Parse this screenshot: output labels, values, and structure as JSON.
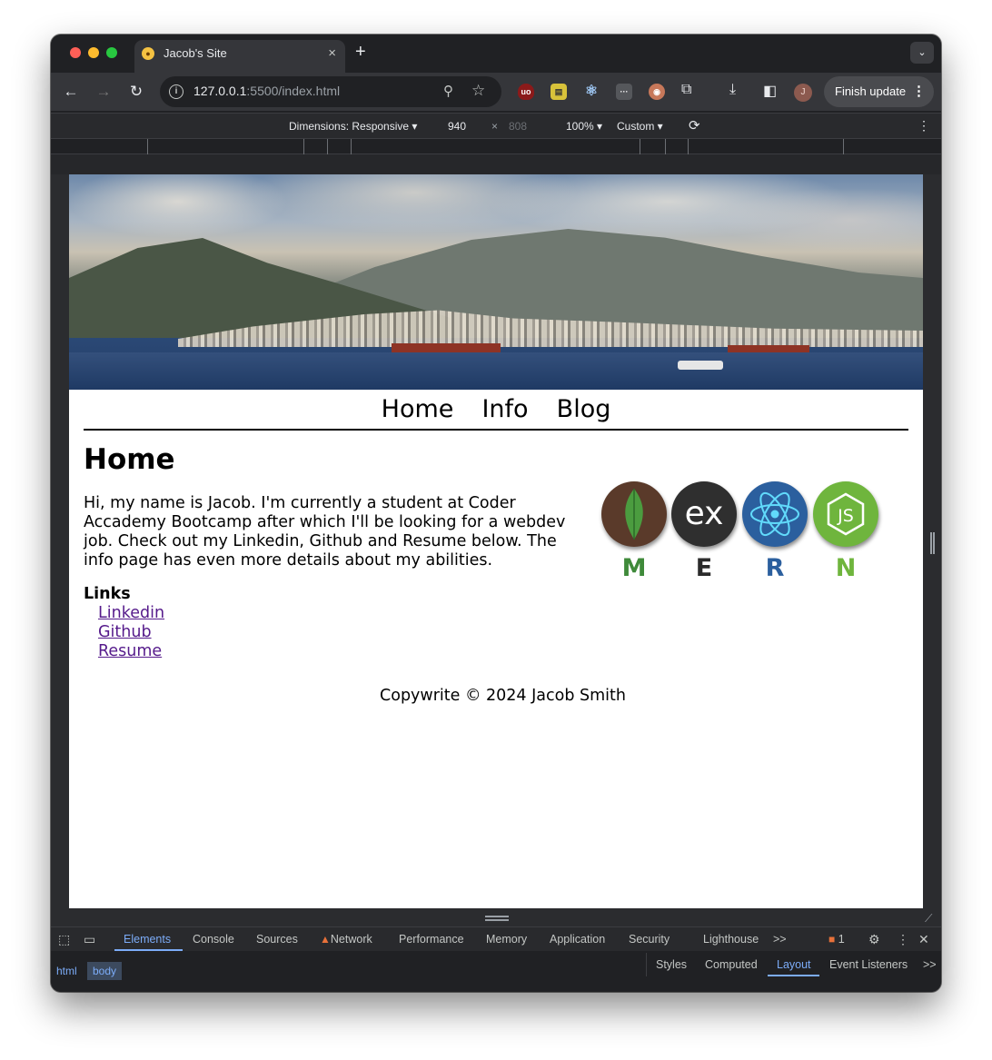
{
  "browser": {
    "tab_title": "Jacob's Site",
    "url_host": "127.0.0.1",
    "url_rest": ":5500/index.html",
    "finish_update": "Finish update",
    "profile_initial": "J",
    "new_tab": "+",
    "tab_close": "×"
  },
  "device_toolbar": {
    "dimensions": "Dimensions: Responsive",
    "width": "940",
    "times": "×",
    "height": "808",
    "zoom": "100%",
    "throttle": "Custom"
  },
  "site": {
    "nav": [
      "Home",
      "Info",
      "Blog"
    ],
    "heading": "Home",
    "intro": "Hi, my name is Jacob. I'm currently a student at Coder Accademy Bootcamp after which I'll be looking for a webdev job. Check out my Linkedin, Github and Resume below. The info page has even more details about my abilities.",
    "links_title": "Links",
    "links": [
      "Linkedin",
      "Github",
      "Resume"
    ],
    "footer": "Copywrite © 2024 Jacob Smith",
    "mern": [
      {
        "letter": "M",
        "icon": "mongodb-leaf-icon",
        "color": "#3f8a3a"
      },
      {
        "letter": "E",
        "icon": "express-icon",
        "color": "#2b2b2b"
      },
      {
        "letter": "R",
        "icon": "react-icon",
        "color": "#2b5f9e"
      },
      {
        "letter": "N",
        "icon": "nodejs-icon",
        "color": "#6fb53d"
      }
    ]
  },
  "devtools": {
    "tabs": [
      "Elements",
      "Console",
      "Sources",
      "Network",
      "Performance",
      "Memory",
      "Application",
      "Security",
      "Lighthouse"
    ],
    "more": ">>",
    "issues_count": "1",
    "breadcrumbs": [
      "html",
      "body"
    ],
    "side_tabs": [
      "Styles",
      "Computed",
      "Layout",
      "Event Listeners"
    ]
  }
}
